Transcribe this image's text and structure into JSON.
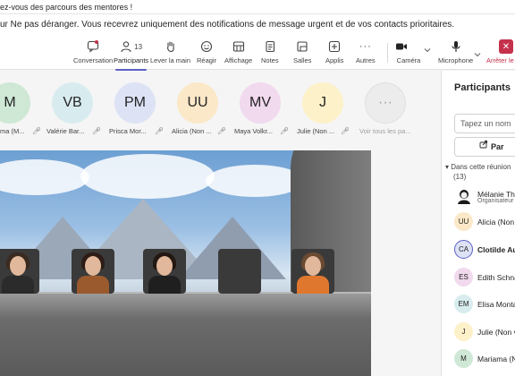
{
  "banner": {
    "text": "ez-vous des parcours des mentores !"
  },
  "notice": {
    "text": "ur Ne pas déranger. Vous recevrez uniquement des notifications de message urgent et de vos contacts prioritaires."
  },
  "toolbar": {
    "conversation": "Conversation",
    "participants": "Participants",
    "participants_count": "13",
    "raise_hand": "Lever la main",
    "react": "Réagir",
    "view": "Affichage",
    "notes": "Notes",
    "rooms": "Salles",
    "apps": "Applis",
    "more": "Autres",
    "camera": "Caméra",
    "mic": "Microphone",
    "leave": "Arrêter le",
    "more_glyph": "···"
  },
  "gallery": [
    {
      "initials": "M",
      "name": "ma (M...",
      "color": "#cfe8d6"
    },
    {
      "initials": "VB",
      "name": "Valérie Bar...",
      "color": "#d8ecef"
    },
    {
      "initials": "PM",
      "name": "Prisca Mor...",
      "color": "#dde2f5"
    },
    {
      "initials": "UU",
      "name": "Alicia (Non ...",
      "color": "#fbe8c8"
    },
    {
      "initials": "MV",
      "name": "Maya Volkr...",
      "color": "#f1d9ee"
    },
    {
      "initials": "J",
      "name": "Julie (Non ...",
      "color": "#fdf1c9"
    },
    {
      "initials": "···",
      "name": "Voir tous les pa...",
      "color": "#ececec"
    }
  ],
  "panel": {
    "title": "Participants",
    "search_placeholder": "Tapez un nom",
    "share_label": "Par",
    "section_label": "Dans cette réunion",
    "section_count": "(13)",
    "people": [
      {
        "initials": "",
        "name": "Mélanie Th",
        "sub": "Organisateur",
        "color": "#ffffff"
      },
      {
        "initials": "UU",
        "name": "Alicia (Non",
        "sub": "",
        "color": "#fbe8c8"
      },
      {
        "initials": "CA",
        "name": "Clotilde Au",
        "sub": "",
        "color": "#dde2f5"
      },
      {
        "initials": "ES",
        "name": "Edith Schna",
        "sub": "",
        "color": "#f1d9ee"
      },
      {
        "initials": "EM",
        "name": "Elisa Monta",
        "sub": "",
        "color": "#d8ecef"
      },
      {
        "initials": "J",
        "name": "Julie (Non v",
        "sub": "",
        "color": "#fdf1c9"
      },
      {
        "initials": "M",
        "name": "Mariama (N",
        "sub": "",
        "color": "#cfe8d6"
      }
    ]
  }
}
